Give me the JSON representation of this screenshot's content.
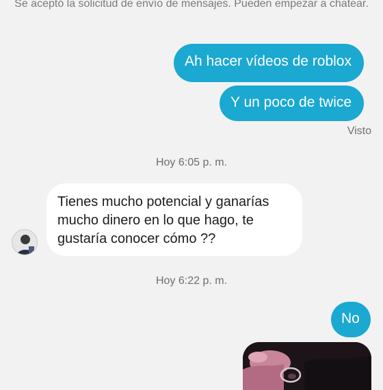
{
  "chat": {
    "request_notice": "Se aceptó la solicitud de envío de mensajes. Pueden empezar a chatear.",
    "messages": [
      {
        "from": "me",
        "text": "Ah hacer vídeos de roblox"
      },
      {
        "from": "me",
        "text": "Y un poco de twice"
      },
      {
        "from": "other",
        "text": "Tienes mucho potencial y ganarías mucho dinero en lo que hago, te gustaría conocer cómo ??"
      },
      {
        "from": "me",
        "text": "No"
      }
    ],
    "seen_label": "Visto",
    "timestamps": [
      "Hoy 6:05 p. m.",
      "Hoy 6:22 p. m."
    ]
  },
  "colors": {
    "outgoing_bubble": "#1ba8d1",
    "incoming_bubble": "#ffffff",
    "background": "#f2f2f2"
  },
  "icons": {
    "contact_avatar": "avatar-photo",
    "attached_photo": "shared-image"
  }
}
